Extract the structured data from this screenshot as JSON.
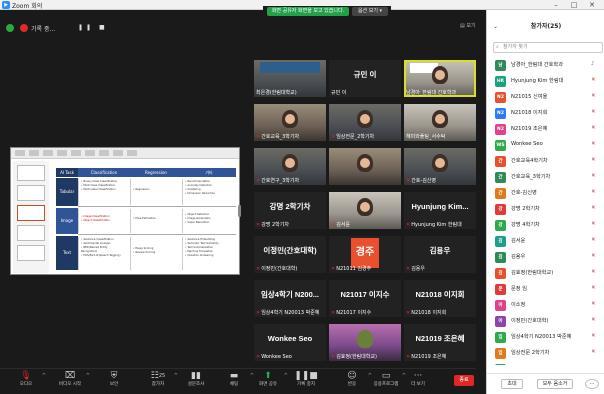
{
  "window": {
    "app_title": "Zoom 회의",
    "minimize": "–",
    "maximize": "□",
    "close": "✕"
  },
  "sharing": {
    "message": "화면 공유자 화면을 보고 있습니다.",
    "options": "옵션 보기 ▾"
  },
  "recording": {
    "status": "기록 중...",
    "controls": "❚❚ ■"
  },
  "view_button": "▤ 보기",
  "slide": {
    "headers": [
      "AI Task",
      "Classification",
      "Regression",
      "기타"
    ],
    "rows": [
      {
        "label": "Tabular",
        "cells": [
          "• Binary Class Classification\n• Multi Class Classification\n• Multi-Label Classification",
          "• Regression",
          "• Recommendation\n• Anomaly Detection\n• Clustering\n• Dimension Reduction"
        ]
      },
      {
        "label": "Image",
        "cells": [
          "• Image Classification\n• Object Classification",
          "• Pose Estimation",
          "• Object Detection\n• Image Generation\n• Super Resolution"
        ]
      },
      {
        "label": "Text",
        "cells": [
          "• Sentence Classification\n• Sentimental Analysis\n• NER(Named Entity\n  Recognition)\n• POS(Part-of-Speech Tagging)",
          "• Essay Scoring\n• Review Scoring",
          "• Sentence Embedding\n• Semantic Text Similarity\n• Text Summarization\n• Machine Translation\n• Question Answering"
        ]
      }
    ]
  },
  "tiles": [
    {
      "big": "",
      "name": "최은경(한림대학교)",
      "muted": false
    },
    {
      "big": "규민 이",
      "name": "규민 이",
      "muted": false
    },
    {
      "big": "",
      "name": "남경아_한림대 간호학과",
      "muted": false
    },
    {
      "big": "",
      "name": "간호교육_3학기차",
      "muted": true
    },
    {
      "big": "",
      "name": "임상전문_2학기차",
      "muted": true
    },
    {
      "big": "",
      "name": "헤미와풀팅_서수탁",
      "muted": false
    },
    {
      "big": "",
      "name": "간호연구_3학기차",
      "muted": true
    },
    {
      "big": "",
      "name": "",
      "muted": false
    },
    {
      "big": "",
      "name": "간호-김신영",
      "muted": true
    },
    {
      "big": "강명 2학기차",
      "name": "강명 2학기차",
      "muted": true
    },
    {
      "big": "",
      "name": "김서윤",
      "muted": true
    },
    {
      "big": "Hyunjung Kim...",
      "name": "Hyunjung Kim 한림대",
      "muted": true
    },
    {
      "big": "이정민(간호대학)",
      "name": "이정민(간호대학)",
      "muted": true
    },
    {
      "big": "",
      "name": "N21011 김경주",
      "muted": true
    },
    {
      "big": "김용우",
      "name": "김용우",
      "muted": true
    },
    {
      "big": "임상4학기 N200...",
      "name": "임상4학기 N20013 박준혜",
      "muted": true
    },
    {
      "big": "N21017 이지수",
      "name": "N21017 이지수",
      "muted": true
    },
    {
      "big": "N21018 이지희",
      "name": "N21018 이지희",
      "muted": true
    },
    {
      "big": "Wonkee Seo",
      "name": "Wonkee Seo",
      "muted": true
    },
    {
      "big": "",
      "name": "김효정(한림대학교)",
      "muted": true
    },
    {
      "big": "N21019 조은혜",
      "name": "N21019 조은혜",
      "muted": true
    }
  ],
  "avatar_tile": {
    "text": "경주"
  },
  "toolbar": {
    "mute": "오디오",
    "video": "비디오 시작",
    "security": "보안",
    "participants": "참가자",
    "participants_count": "25",
    "polls": "설문조사",
    "chat": "채팅",
    "share": "화면 공유",
    "record": "기록 중지",
    "reactions": "반응",
    "apps": "응용프로그램",
    "more": "더 보기",
    "end": "종료"
  },
  "panel": {
    "title": "참가자(25)",
    "search_placeholder": "참가자 찾기",
    "invite": "초대",
    "mute_all": "모두 음소거",
    "more": "···",
    "participants": [
      {
        "initials": "남",
        "name": "남경아_한림대 간호학과",
        "color": "#2e8b57",
        "muted": false
      },
      {
        "initials": "HK",
        "name": "Hyunjung Kim 한림대",
        "color": "#1aa37a",
        "muted": true
      },
      {
        "initials": "N2",
        "name": "N21015 신여울",
        "color": "#e8502e",
        "muted": true
      },
      {
        "initials": "N2",
        "name": "N21018 이지희",
        "color": "#2d7cf5",
        "muted": true
      },
      {
        "initials": "N2",
        "name": "N21019 조은혜",
        "color": "#e0418b",
        "muted": true
      },
      {
        "initials": "WS",
        "name": "Wonkee Seo",
        "color": "#2faa4a",
        "muted": true
      },
      {
        "initials": "간",
        "name": "간호교육4학기차",
        "color": "#e8502e",
        "muted": true
      },
      {
        "initials": "간",
        "name": "간호교육_3학기차",
        "color": "#2e8b57",
        "muted": true
      },
      {
        "initials": "간",
        "name": "간호-김신영",
        "color": "#e07a1f",
        "muted": true
      },
      {
        "initials": "강",
        "name": "강명 2학기차",
        "color": "#e03a3a",
        "muted": true
      },
      {
        "initials": "강",
        "name": "강명 4학기차",
        "color": "#2faa4a",
        "muted": true
      },
      {
        "initials": "김",
        "name": "김서윤",
        "color": "#1f9e8e",
        "muted": true
      },
      {
        "initials": "김",
        "name": "김용우",
        "color": "#2e8b57",
        "muted": true
      },
      {
        "initials": "김",
        "name": "김효정(한림대학교)",
        "color": "#e8502e",
        "muted": true
      },
      {
        "initials": "문",
        "name": "문정 임",
        "color": "#e03a3a",
        "muted": true
      },
      {
        "initials": "이",
        "name": "이소정",
        "color": "#e0418b",
        "muted": true
      },
      {
        "initials": "이",
        "name": "이정민(간호대학)",
        "color": "#8e44ad",
        "muted": true
      },
      {
        "initials": "임",
        "name": "임상4학기 N20013 박준혜",
        "color": "#2faa4a",
        "muted": true
      },
      {
        "initials": "임",
        "name": "임상전문 2학기차",
        "color": "#e07a1f",
        "muted": true
      },
      {
        "initials": "정",
        "name": "정보리(한림대학교)",
        "color": "#1f9e8e",
        "muted": true
      }
    ]
  },
  "colors": {
    "accent": "#2d8cff",
    "end": "#e02828",
    "active_speaker": "#d9e021",
    "share_banner": "#23a14a"
  }
}
